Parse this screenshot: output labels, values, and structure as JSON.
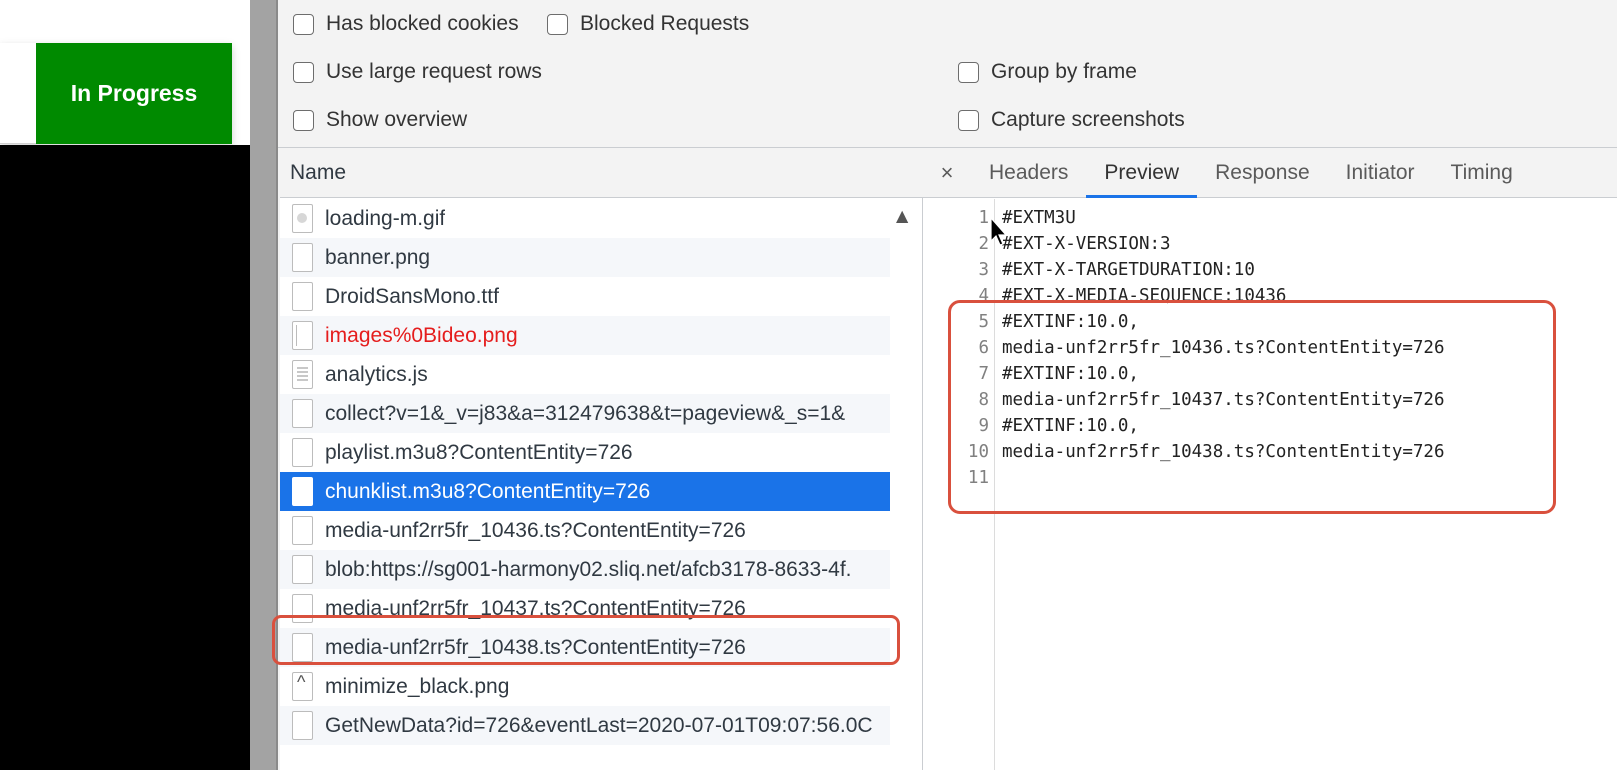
{
  "page": {
    "status_button": "In Progress"
  },
  "settings": {
    "has_blocked_cookies": "Has blocked cookies",
    "blocked_requests": "Blocked Requests",
    "use_large_request_rows": "Use large request rows",
    "group_by_frame": "Group by frame",
    "show_overview": "Show overview",
    "capture_screenshots": "Capture screenshots"
  },
  "requests": {
    "column_header": "Name",
    "items": [
      {
        "name": "loading-m.gif",
        "icon": "gif-file-icon",
        "kind": "gif",
        "state": ""
      },
      {
        "name": "banner.png",
        "icon": "file-icon",
        "kind": "",
        "state": ""
      },
      {
        "name": "DroidSansMono.ttf",
        "icon": "file-icon",
        "kind": "",
        "state": ""
      },
      {
        "name": "images%0Bideo.png",
        "icon": "image-file-icon",
        "kind": "img2",
        "state": "error"
      },
      {
        "name": "analytics.js",
        "icon": "script-file-icon",
        "kind": "script",
        "state": ""
      },
      {
        "name": "collect?v=1&_v=j83&a=312479638&t=pageview&_s=1&",
        "icon": "file-icon",
        "kind": "",
        "state": ""
      },
      {
        "name": "playlist.m3u8?ContentEntity=726",
        "icon": "file-icon",
        "kind": "",
        "state": ""
      },
      {
        "name": "chunklist.m3u8?ContentEntity=726",
        "icon": "file-icon",
        "kind": "",
        "state": "selected"
      },
      {
        "name": "media-unf2rr5fr_10436.ts?ContentEntity=726",
        "icon": "file-icon",
        "kind": "",
        "state": ""
      },
      {
        "name": "blob:https://sg001-harmony02.sliq.net/afcb3178-8633-4f.",
        "icon": "file-icon",
        "kind": "",
        "state": ""
      },
      {
        "name": "media-unf2rr5fr_10437.ts?ContentEntity=726",
        "icon": "file-icon",
        "kind": "",
        "state": ""
      },
      {
        "name": "media-unf2rr5fr_10438.ts?ContentEntity=726",
        "icon": "file-icon",
        "kind": "",
        "state": ""
      },
      {
        "name": "minimize_black.png",
        "icon": "chevron-up-file-icon",
        "kind": "up",
        "state": ""
      },
      {
        "name": "GetNewData?id=726&eventLast=2020-07-01T09:07:56.0C",
        "icon": "file-icon",
        "kind": "",
        "state": ""
      }
    ]
  },
  "detail": {
    "close": "×",
    "tabs": [
      "Headers",
      "Preview",
      "Response",
      "Initiator",
      "Timing"
    ],
    "active_tab": "Preview",
    "lines": [
      {
        "n": "1",
        "text": "#EXTM3U"
      },
      {
        "n": "2",
        "text": "#EXT-X-VERSION:3"
      },
      {
        "n": "3",
        "text": "#EXT-X-TARGETDURATION:10"
      },
      {
        "n": "4",
        "text": "#EXT-X-MEDIA-SEQUENCE:10436"
      },
      {
        "n": "5",
        "text": "#EXTINF:10.0,"
      },
      {
        "n": "6",
        "text": "media-unf2rr5fr_10436.ts?ContentEntity=726"
      },
      {
        "n": "7",
        "text": "#EXTINF:10.0,"
      },
      {
        "n": "8",
        "text": "media-unf2rr5fr_10437.ts?ContentEntity=726"
      },
      {
        "n": "9",
        "text": "#EXTINF:10.0,"
      },
      {
        "n": "10",
        "text": "media-unf2rr5fr_10438.ts?ContentEntity=726"
      },
      {
        "n": "11",
        "text": ""
      }
    ]
  },
  "colors": {
    "selected_row": "#1a73e8",
    "error_text": "#e51d1d",
    "status_button": "#008a00",
    "callout": "#d9503d"
  }
}
